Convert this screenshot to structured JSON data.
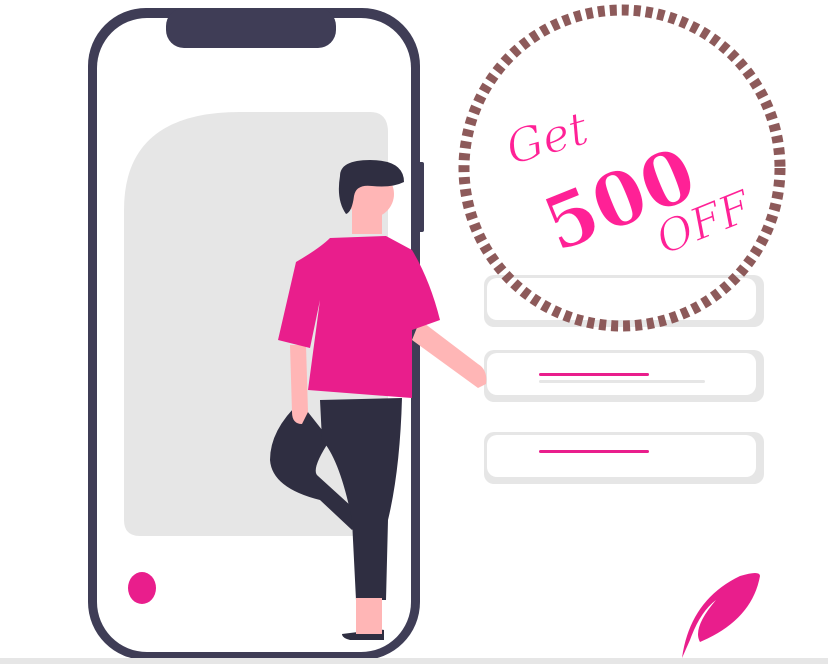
{
  "promo": {
    "line1": "Get",
    "amount": "500",
    "line3": "OFF"
  },
  "colors": {
    "accent": "#e91e8c",
    "dark": "#3f3d56",
    "stamp": "#8d5a5a",
    "light_gray": "#e6e6e6",
    "skin": "#ffb6b6"
  }
}
